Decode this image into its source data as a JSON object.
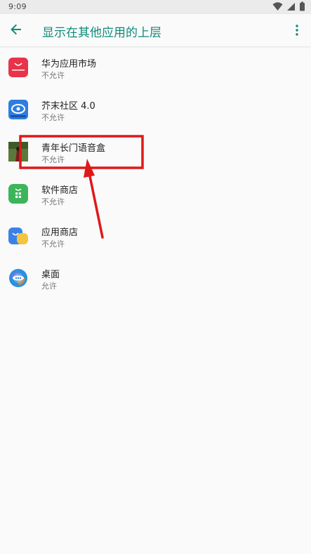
{
  "status_bar": {
    "time": "9:09"
  },
  "header": {
    "title": "显示在其他应用的上层"
  },
  "apps": [
    {
      "name": "华为应用市场",
      "status": "不允许",
      "icon": "huawei-appgallery-icon"
    },
    {
      "name": "芥末社区 4.0",
      "status": "不允许",
      "icon": "jiemo-community-icon"
    },
    {
      "name": "青年长门语音盒",
      "status": "不允许",
      "icon": "voice-box-icon"
    },
    {
      "name": "软件商店",
      "status": "不允许",
      "icon": "software-store-icon"
    },
    {
      "name": "应用商店",
      "status": "不允许",
      "icon": "app-store-icon"
    },
    {
      "name": "桌面",
      "status": "允许",
      "icon": "nox-launcher-icon"
    }
  ],
  "colors": {
    "accent": "#0f8a78",
    "annotation": "#e01818",
    "background": "#fafafa"
  }
}
